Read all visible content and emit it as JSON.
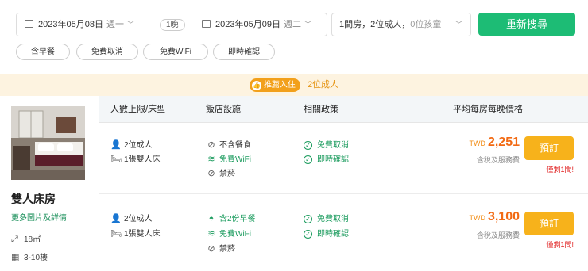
{
  "search": {
    "checkin_date": "2023年05月08日",
    "checkin_week": "週一",
    "nights": "1晚",
    "checkout_date": "2023年05月09日",
    "checkout_week": "週二",
    "guests_main": "1間房，2位成人，",
    "guests_children": "0位孩童",
    "search_button": "重新搜尋"
  },
  "filters": [
    "含早餐",
    "免費取消",
    "免費WiFi",
    "即時確認"
  ],
  "recommend": {
    "badge": "推薦入住",
    "text": "2位成人"
  },
  "room": {
    "name": "雙人床房",
    "more_link": "更多圖片及詳情",
    "size": "18㎡",
    "floor": "3-10樓"
  },
  "table_headers": {
    "occupancy": "人數上限/床型",
    "facilities": "飯店設施",
    "policy": "相關政策",
    "price": "平均每房每晚價格"
  },
  "rows": [
    {
      "occupancy": "2位成人",
      "bed": "1張雙人床",
      "meal": "不含餐食",
      "wifi": "免費WiFi",
      "smoking": "禁菸",
      "policy1": "免費取消",
      "policy2": "即時確認",
      "currency": "TWD",
      "amount": "2,251",
      "tax": "含稅及服務費",
      "book": "預訂",
      "remain": "僅剩1間!"
    },
    {
      "occupancy": "2位成人",
      "bed": "1張雙人床",
      "meal": "含2份早餐",
      "wifi": "免費WiFi",
      "smoking": "禁菸",
      "policy1": "免費取消",
      "policy2": "即時確認",
      "currency": "TWD",
      "amount": "3,100",
      "tax": "含稅及服務費",
      "book": "預訂",
      "remain": "僅剩1間!"
    }
  ],
  "colors": {
    "accent_green": "#1dbc75",
    "book_orange": "#f7b21b",
    "price_orange": "#f26a13",
    "recommend_bg": "#fdf3e0"
  }
}
